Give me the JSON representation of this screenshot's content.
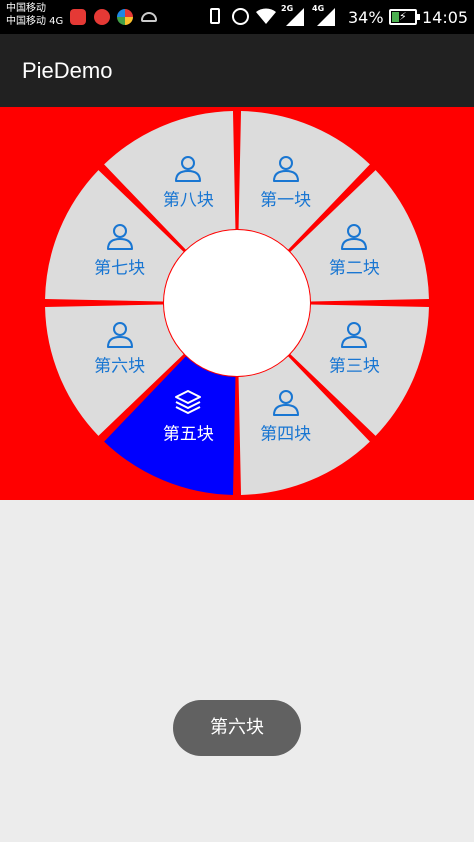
{
  "status_bar": {
    "carrier_1": "中国移动",
    "carrier_2": "中国移动 4G",
    "net_2g": "2G",
    "net_4g": "4G",
    "battery": "34%",
    "time": "14:05",
    "battery_level": 0.34
  },
  "app": {
    "title": "PieDemo"
  },
  "pie": {
    "background_color": "#ff0000",
    "segment_color": "#dcdcdc",
    "selected_color": "#0000ff",
    "label_color": "#1976d2",
    "segments": [
      {
        "label": "第一块",
        "icon": "user-icon",
        "selected": false
      },
      {
        "label": "第二块",
        "icon": "user-icon",
        "selected": false
      },
      {
        "label": "第三块",
        "icon": "user-icon",
        "selected": false
      },
      {
        "label": "第四块",
        "icon": "user-icon",
        "selected": false
      },
      {
        "label": "第五块",
        "icon": "layers-icon",
        "selected": true
      },
      {
        "label": "第六块",
        "icon": "user-icon",
        "selected": false
      },
      {
        "label": "第七块",
        "icon": "user-icon",
        "selected": false
      },
      {
        "label": "第八块",
        "icon": "user-icon",
        "selected": false
      }
    ]
  },
  "toast": {
    "text": "第六块"
  }
}
